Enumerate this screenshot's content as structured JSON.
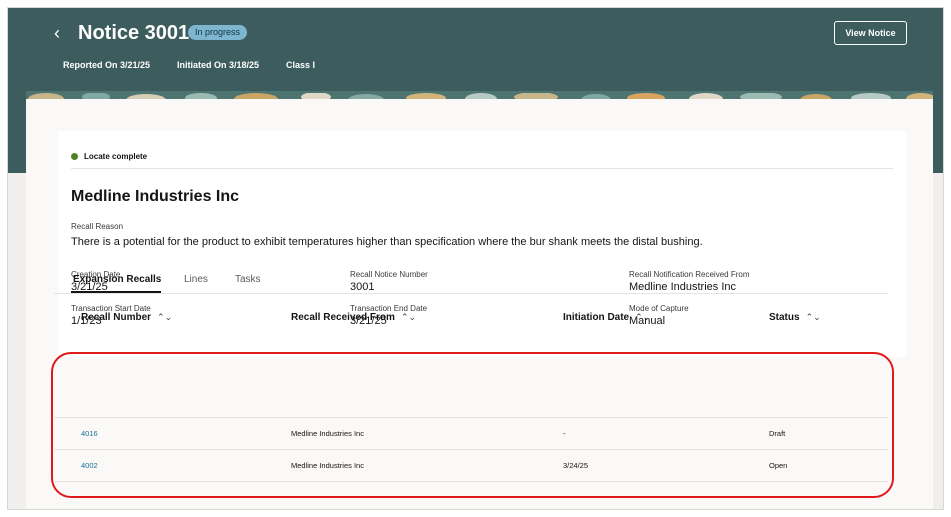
{
  "header": {
    "title": "Notice 3001",
    "status_badge": "In progress",
    "reported_on": "Reported On 3/21/25",
    "initiated_on": "Initiated On 3/18/25",
    "class": "Class I",
    "view_notice_label": "View Notice"
  },
  "card": {
    "locate_status": "Locate complete",
    "company": "Medline Industries Inc",
    "recall_reason_label": "Recall Reason",
    "recall_reason": "There is a potential for the product to exhibit temperatures higher than specification where the bur shank meets the distal bushing.",
    "fields": [
      {
        "label": "Creation Date",
        "value": "3/21/25"
      },
      {
        "label": "Recall Notice Number",
        "value": "3001"
      },
      {
        "label": "Recall Notification Received From",
        "value": "Medline Industries Inc"
      },
      {
        "label": "Transaction Start Date",
        "value": "1/1/23"
      },
      {
        "label": "Transaction End Date",
        "value": "3/21/25"
      },
      {
        "label": "Mode of Capture",
        "value": "Manual"
      }
    ]
  },
  "tabs": [
    {
      "label": "Expansion Recalls",
      "active": true
    },
    {
      "label": "Lines",
      "active": false
    },
    {
      "label": "Tasks",
      "active": false
    }
  ],
  "table": {
    "headers": [
      "Recall Number",
      "Recall Received From",
      "Initiation Date",
      "Status"
    ],
    "sort_icon": "up-down-chevron-icon",
    "rows": [
      [
        "4016",
        "Medline Industries Inc",
        "-",
        "Draft"
      ],
      [
        "4002",
        "Medline Industries Inc",
        "3/24/25",
        "Open"
      ]
    ]
  },
  "colors": {
    "header_bg": "#3d5c5e",
    "badge_bg": "#7fb6cf",
    "link": "#1b6f99",
    "success": "#508223",
    "highlight_outline": "#e01919"
  }
}
